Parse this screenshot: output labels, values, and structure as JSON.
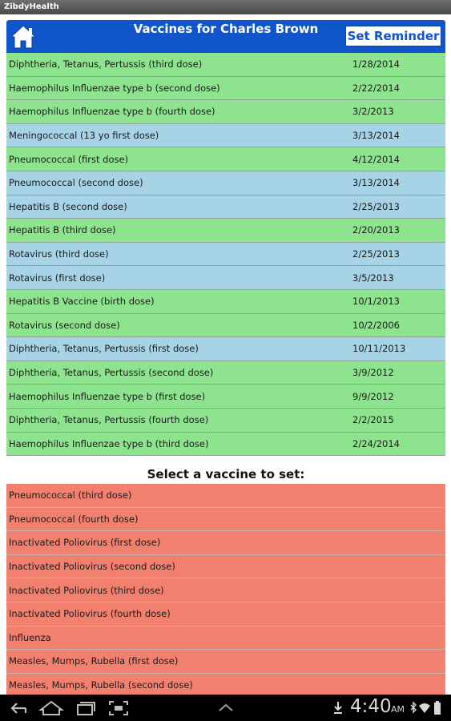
{
  "app": {
    "window_title": "ZibdyHealth"
  },
  "header": {
    "title": "Vaccines for Charles Brown",
    "set_reminder_label": "Set Reminder",
    "color": "#1155cc"
  },
  "given_vaccines": [
    {
      "name": "Diphtheria, Tetanus, Pertussis (third dose)",
      "date": "1/28/2014",
      "color": "green"
    },
    {
      "name": "Haemophilus Influenzae type b (second dose)",
      "date": "2/22/2014",
      "color": "green"
    },
    {
      "name": "Haemophilus Influenzae type b (fourth dose)",
      "date": "3/2/2013",
      "color": "green"
    },
    {
      "name": "Meningococcal (13 yo first dose)",
      "date": "3/13/2014",
      "color": "blue"
    },
    {
      "name": "Pneumococcal (first dose)",
      "date": "4/12/2014",
      "color": "green"
    },
    {
      "name": "Pneumococcal (second dose)",
      "date": "3/13/2014",
      "color": "blue"
    },
    {
      "name": "Hepatitis B (second dose)",
      "date": "2/25/2013",
      "color": "blue"
    },
    {
      "name": "Hepatitis B (third dose)",
      "date": "2/20/2013",
      "color": "green"
    },
    {
      "name": "Rotavirus (third dose)",
      "date": "2/25/2013",
      "color": "blue"
    },
    {
      "name": "Rotavirus (first dose)",
      "date": "3/5/2013",
      "color": "blue"
    },
    {
      "name": "Hepatitis B Vaccine (birth dose)",
      "date": "10/1/2013",
      "color": "green"
    },
    {
      "name": "Rotavirus (second dose)",
      "date": "10/2/2006",
      "color": "green"
    },
    {
      "name": "Diphtheria, Tetanus, Pertussis (first dose)",
      "date": "10/11/2013",
      "color": "blue"
    },
    {
      "name": "Diphtheria, Tetanus, Pertussis (second dose)",
      "date": "3/9/2012",
      "color": "green"
    },
    {
      "name": "Haemophilus Influenzae type b (first dose)",
      "date": "9/9/2012",
      "color": "green"
    },
    {
      "name": "Diphtheria, Tetanus, Pertussis (fourth dose)",
      "date": "2/2/2015",
      "color": "green"
    },
    {
      "name": "Haemophilus Influenzae type b (third dose)",
      "date": "2/24/2014",
      "color": "green"
    }
  ],
  "select_label": "Select a vaccine to set:",
  "pending_vaccines": [
    {
      "name": "Pneumococcal (third dose)"
    },
    {
      "name": "Pneumococcal (fourth dose)"
    },
    {
      "name": "Inactivated Poliovirus (first dose)"
    },
    {
      "name": "Inactivated Poliovirus (second dose)"
    },
    {
      "name": "Inactivated Poliovirus (third dose)"
    },
    {
      "name": "Inactivated Poliovirus (fourth dose)"
    },
    {
      "name": "Influenza"
    },
    {
      "name": "Measles, Mumps, Rubella (first dose)"
    },
    {
      "name": "Measles, Mumps, Rubella (second dose)"
    }
  ],
  "colors": {
    "green": "#8ee38e",
    "blue": "#a6d3e6",
    "red": "#f2806f"
  },
  "system_bar": {
    "time": "4:40",
    "ampm": "AM",
    "icons": [
      "back-icon",
      "home-icon",
      "recent-apps-icon",
      "screenshot-icon",
      "menu-up-icon",
      "download-icon",
      "bluetooth-icon",
      "wifi-icon",
      "battery-icon"
    ]
  }
}
